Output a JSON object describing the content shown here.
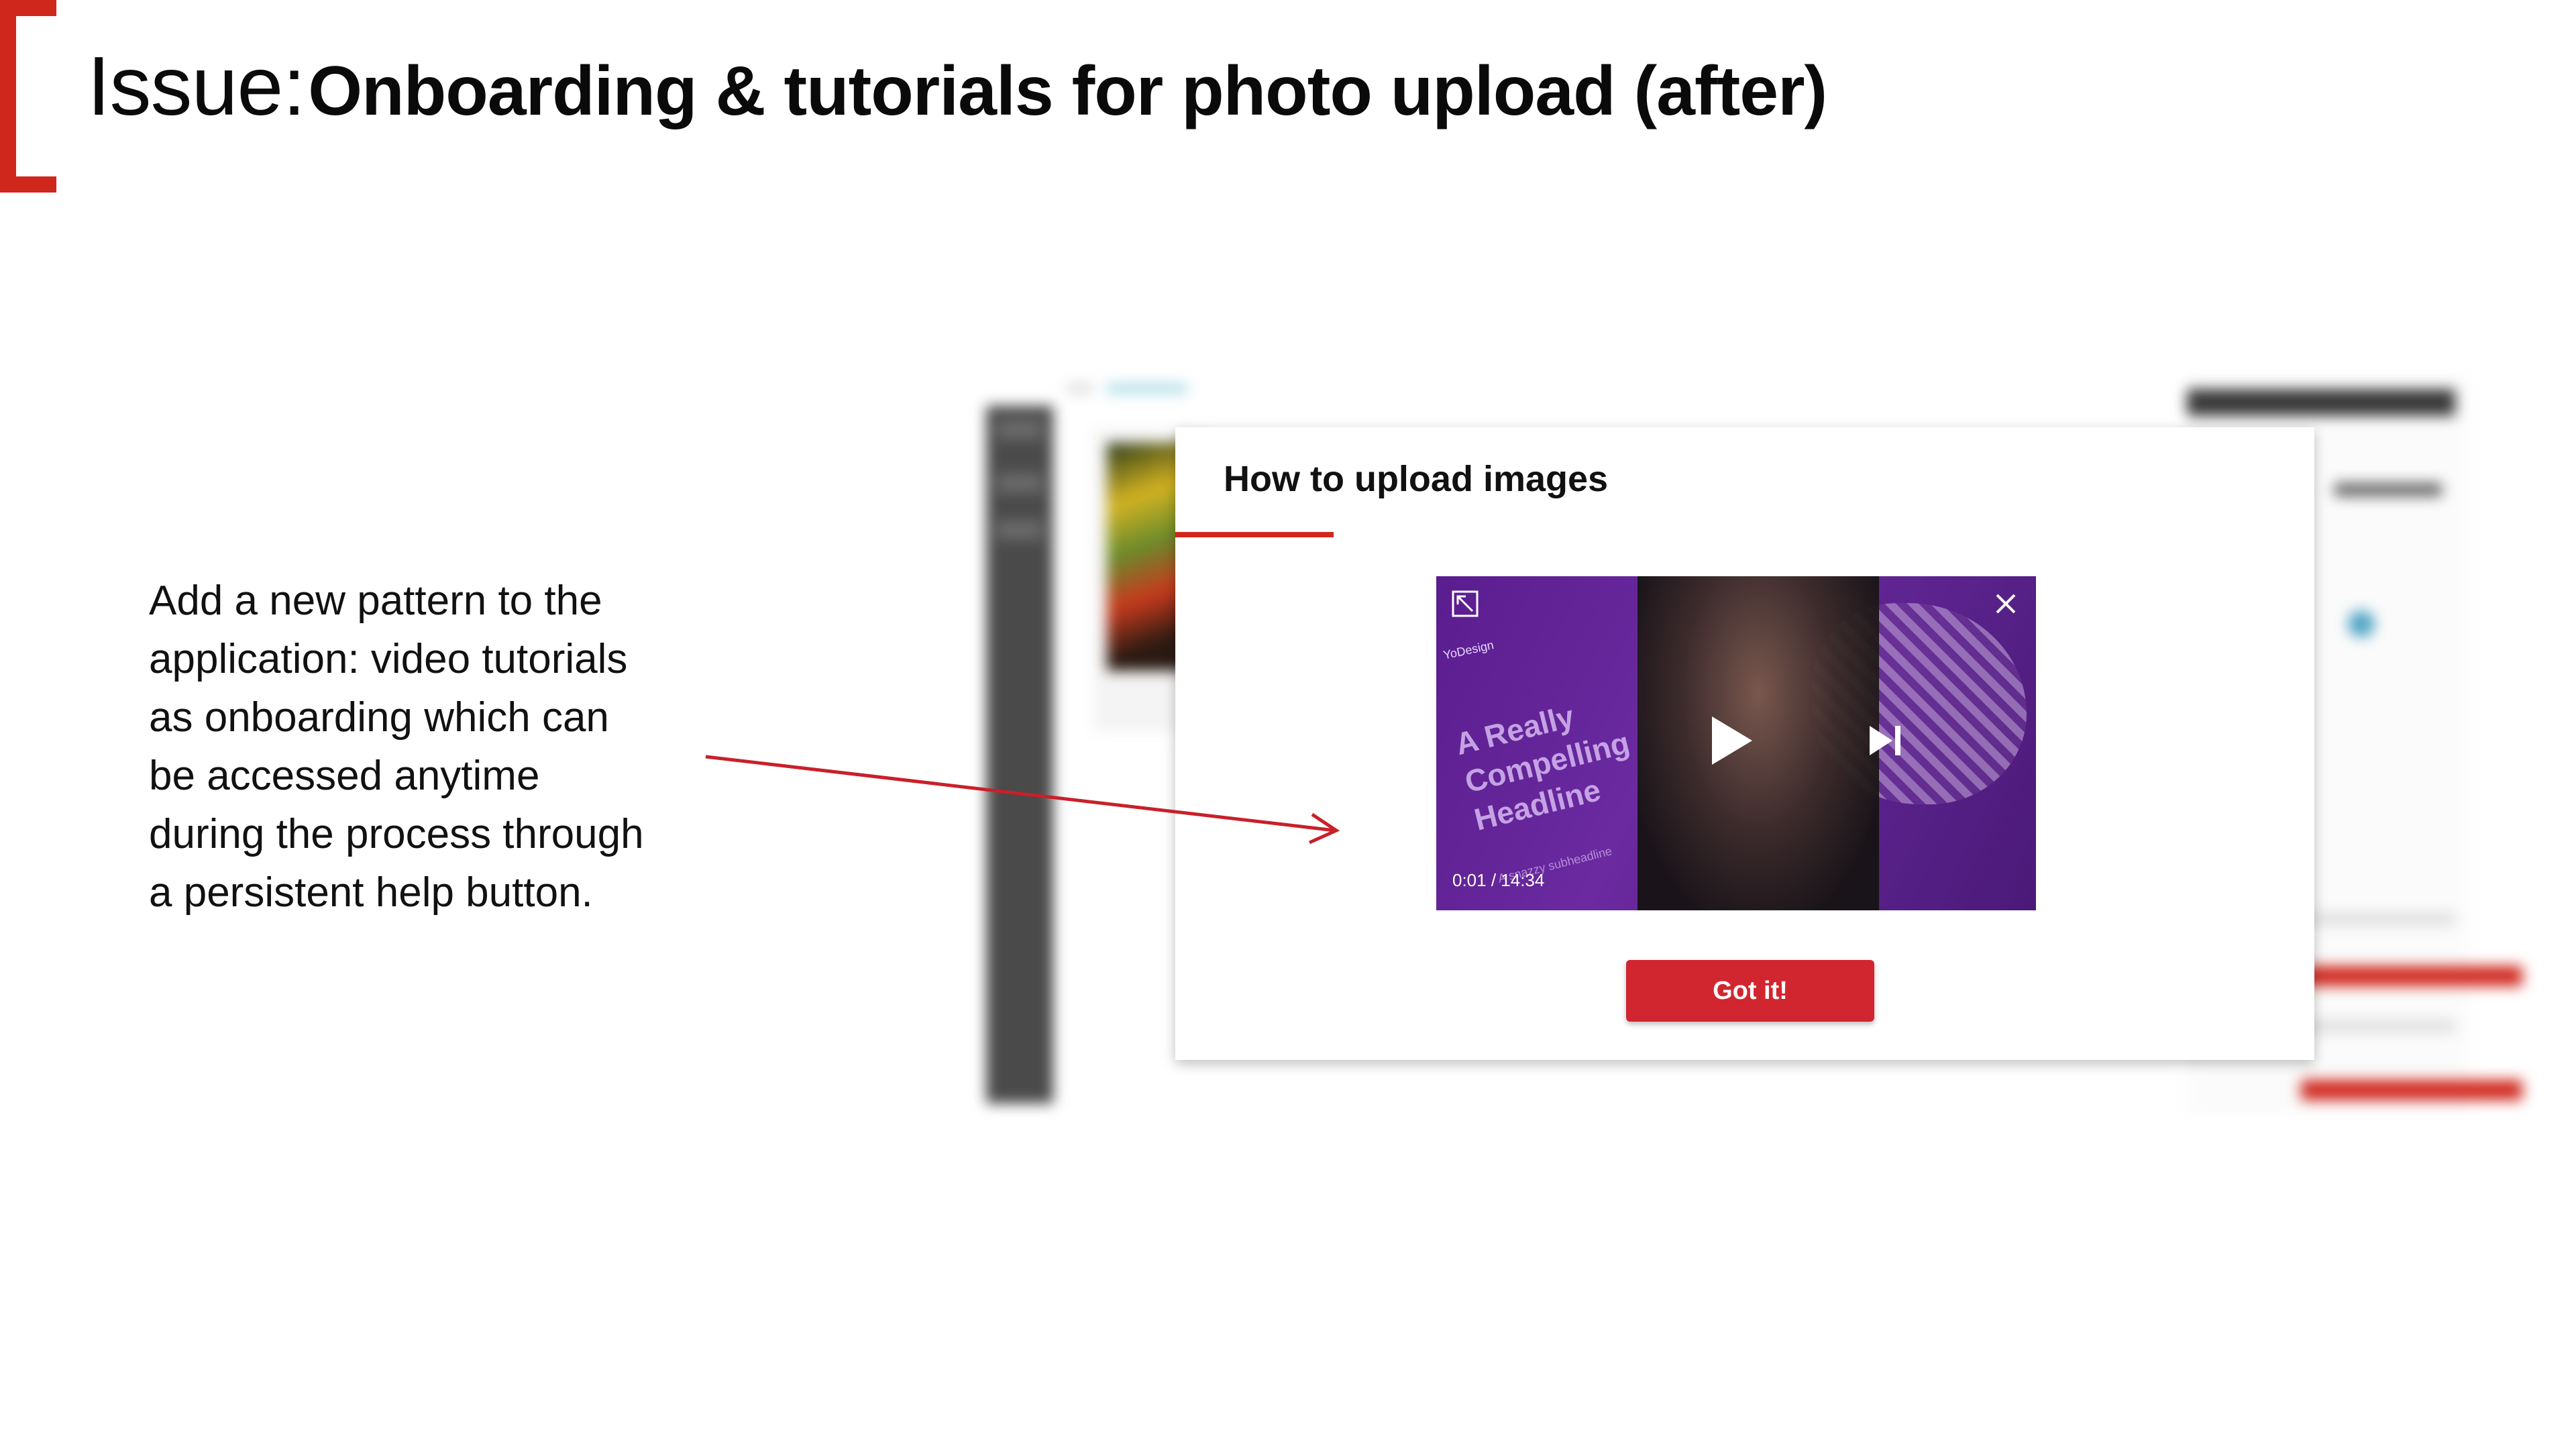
{
  "slide": {
    "title_lead": "Issue:",
    "title_rest": "Onboarding & tutorials for photo upload (after)",
    "description_lines": [
      "Add a new pattern to the",
      "application: video tutorials",
      "as onboarding which can",
      "be accessed anytime",
      "during the process through",
      "a persistent help button."
    ]
  },
  "modal": {
    "title": "How to upload images",
    "video": {
      "brand_text": "YoDesign",
      "headline_lines": [
        "A Really",
        "Compelling",
        "Headline"
      ],
      "subtext": "A snazzy subheadline",
      "time": "0:01 / 14:34",
      "icons": [
        "expand-icon",
        "close-icon",
        "play-icon",
        "skip-next-icon"
      ]
    },
    "confirm_label": "Got it!"
  },
  "colors": {
    "accent_red": "#d0271d",
    "button_red": "#d1262f",
    "video_purple": "#5a1d8f"
  }
}
